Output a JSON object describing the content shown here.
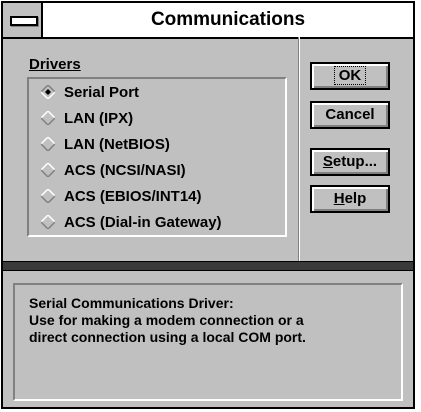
{
  "window": {
    "title": "Communications",
    "colors": {
      "face": "#c0c0c0",
      "title_bg": "#ffffff",
      "frame": "#000000"
    }
  },
  "drivers": {
    "label": "Drivers",
    "selected": "Serial Port",
    "options": [
      {
        "label": "Serial Port",
        "selected": true
      },
      {
        "label": "LAN (IPX)",
        "selected": false
      },
      {
        "label": "LAN (NetBIOS)",
        "selected": false
      },
      {
        "label": "ACS (NCSI/NASI)",
        "selected": false
      },
      {
        "label": "ACS (EBIOS/INT14)",
        "selected": false
      },
      {
        "label": "ACS (Dial-in Gateway)",
        "selected": false
      }
    ]
  },
  "buttons": {
    "ok": {
      "label": "OK"
    },
    "cancel": {
      "label": "Cancel"
    },
    "setup": {
      "label": "Setup...",
      "mnemonic": "S",
      "rest": "etup..."
    },
    "help": {
      "label": "Help",
      "mnemonic": "H",
      "rest": "elp"
    }
  },
  "description": {
    "lines": [
      "Serial Communications Driver:",
      "Use for making a modem connection or a",
      "direct connection using a local COM port."
    ]
  }
}
